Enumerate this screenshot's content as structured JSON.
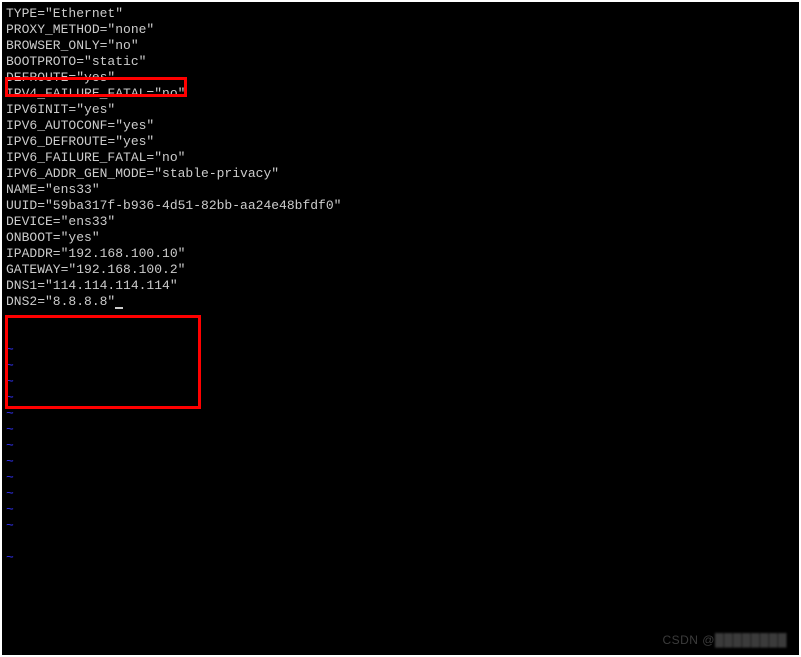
{
  "config_lines": [
    "TYPE=\"Ethernet\"",
    "PROXY_METHOD=\"none\"",
    "BROWSER_ONLY=\"no\"",
    "BOOTPROTO=\"static\"",
    "DEFROUTE=\"yes\"",
    "IPV4_FAILURE_FATAL=\"no\"",
    "IPV6INIT=\"yes\"",
    "IPV6_AUTOCONF=\"yes\"",
    "IPV6_DEFROUTE=\"yes\"",
    "IPV6_FAILURE_FATAL=\"no\"",
    "IPV6_ADDR_GEN_MODE=\"stable-privacy\"",
    "NAME=\"ens33\"",
    "UUID=\"59ba317f-b936-4d51-82bb-aa24e48bfdf0\"",
    "DEVICE=\"ens33\"",
    "ONBOOT=\"yes\"",
    "IPADDR=\"192.168.100.10\"",
    "GATEWAY=\"192.168.100.2\"",
    "DNS1=\"114.114.114.114\"",
    "DNS2=\"8.8.8.8\""
  ],
  "tilde_char": "~",
  "tilde_count": 14,
  "watermark": "CSDN @"
}
